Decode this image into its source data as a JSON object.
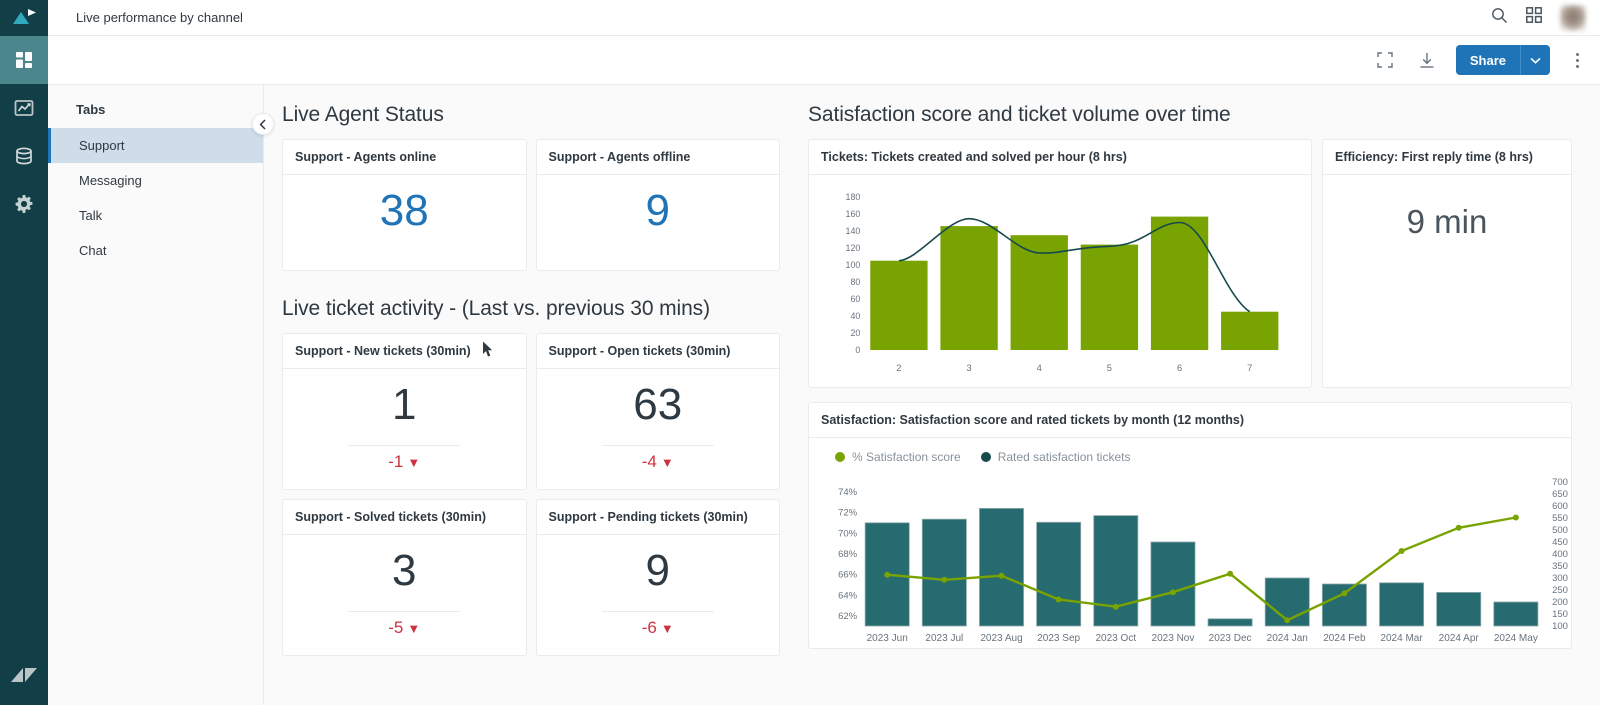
{
  "app": {
    "title": "Live performance by channel",
    "rail": [
      {
        "name": "zendesk-explore-logo-icon",
        "label": "Explore"
      },
      {
        "name": "dashboards-icon",
        "label": "Dashboards",
        "active": true
      },
      {
        "name": "reports-icon",
        "label": "Reports"
      },
      {
        "name": "datasets-icon",
        "label": "Datasets"
      },
      {
        "name": "settings-gear-icon",
        "label": "Admin"
      }
    ],
    "rail_bottom_icon": "zendesk-logo-icon"
  },
  "topbar": {
    "search_icon": "search-icon",
    "apps_icon": "grid-apps-icon",
    "avatar": "user-avatar"
  },
  "toolbar": {
    "fullscreen_icon": "expand-fullscreen-icon",
    "download_icon": "download-icon",
    "share_label": "Share",
    "share_caret_icon": "chevron-down-icon",
    "more_icon": "kebab-menu-icon",
    "accent_color": "#1f73b7"
  },
  "tabs_pane": {
    "heading": "Tabs",
    "collapse_icon": "chevron-left-icon",
    "items": [
      {
        "label": "Support",
        "active": true
      },
      {
        "label": "Messaging",
        "active": false
      },
      {
        "label": "Talk",
        "active": false
      },
      {
        "label": "Chat",
        "active": false
      }
    ]
  },
  "sections": {
    "agent_status_title": "Live Agent Status",
    "ticket_activity_title": "Live ticket activity - (Last vs. previous 30 mins)",
    "right_title": "Satisfaction score and ticket volume over time"
  },
  "agent_cards": [
    {
      "title": "Support - Agents online",
      "value": "38",
      "color": "#1f73b7"
    },
    {
      "title": "Support - Agents offline",
      "value": "9",
      "color": "#1f73b7"
    }
  ],
  "ticket_cards": [
    {
      "title": "Support - New tickets (30min)",
      "value": "1",
      "delta": "-1",
      "trend": "down"
    },
    {
      "title": "Support - Open tickets (30min)",
      "value": "63",
      "delta": "-4",
      "trend": "down"
    },
    {
      "title": "Support - Solved tickets (30min)",
      "value": "3",
      "delta": "-5",
      "trend": "down"
    },
    {
      "title": "Support - Pending tickets (30min)",
      "value": "9",
      "delta": "-6",
      "trend": "down"
    }
  ],
  "efficiency_card": {
    "title": "Efficiency: First reply time (8 hrs)",
    "value": "9 min"
  },
  "tickets_card": {
    "title": "Tickets: Tickets created and solved per hour (8 hrs)"
  },
  "satisfaction_card": {
    "title": "Satisfaction: Satisfaction score and rated tickets by month (12 months)",
    "legend": [
      {
        "label": "% Satisfaction score",
        "color": "#78a300"
      },
      {
        "label": "Rated satisfaction tickets",
        "color": "#17494d"
      }
    ]
  },
  "chart_data": [
    {
      "type": "bar",
      "id": "tickets-per-hour",
      "title": "Tickets: Tickets created and solved per hour (8 hrs)",
      "xlabel": "",
      "ylabel": "",
      "categories": [
        "2",
        "3",
        "4",
        "5",
        "6",
        "7"
      ],
      "yticks": [
        0,
        20,
        40,
        60,
        80,
        100,
        120,
        140,
        160,
        180
      ],
      "ylim": [
        0,
        180
      ],
      "grid": false,
      "legend_position": "none",
      "series": [
        {
          "name": "Tickets created",
          "type": "bar",
          "color": "#78a300",
          "values": [
            105,
            146,
            135,
            124,
            157,
            45
          ]
        },
        {
          "name": "Tickets solved",
          "type": "line",
          "color": "#17494d",
          "values": [
            105,
            155,
            114,
            122,
            150,
            45
          ]
        }
      ]
    },
    {
      "type": "bar",
      "id": "satisfaction-by-month",
      "title": "Satisfaction: Satisfaction score and rated tickets by month (12 months)",
      "xlabel": "",
      "ylabel": "",
      "categories": [
        "2023 Jun",
        "2023 Jul",
        "2023 Aug",
        "2023 Sep",
        "2023 Oct",
        "2023 Nov",
        "2023 Dec",
        "2024 Jan",
        "2024 Feb",
        "2024 Mar",
        "2024 Apr",
        "2024 May"
      ],
      "left_axis": {
        "name": "% Satisfaction score",
        "ticks": [
          "62%",
          "64%",
          "66%",
          "68%",
          "70%",
          "72%",
          "74%"
        ],
        "ylim": [
          61,
          75
        ]
      },
      "right_axis": {
        "name": "Rated satisfaction tickets",
        "ticks": [
          100,
          150,
          200,
          250,
          300,
          350,
          400,
          450,
          500,
          550,
          600,
          650,
          700
        ],
        "ylim": [
          100,
          700
        ]
      },
      "grid": false,
      "legend_position": "top-left",
      "series": [
        {
          "name": "Rated satisfaction tickets",
          "type": "bar",
          "axis": "right",
          "color": "#17494d",
          "values": [
            530,
            545,
            590,
            532,
            560,
            450,
            130,
            300,
            275,
            280,
            240,
            200
          ]
        },
        {
          "name": "% Satisfaction score",
          "type": "line",
          "axis": "left",
          "color": "#78a300",
          "values": [
            66.0,
            65.5,
            65.9,
            63.6,
            62.9,
            64.3,
            66.1,
            61.6,
            64.2,
            68.3,
            70.5,
            71.5
          ]
        }
      ]
    }
  ]
}
